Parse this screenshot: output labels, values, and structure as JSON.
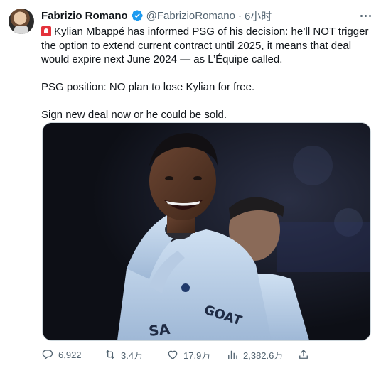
{
  "author": {
    "name": "Fabrizio Romano",
    "handle": "@FabrizioRomano",
    "separator": "·",
    "time": "6小时"
  },
  "tweet": {
    "paragraph1": "Kylian Mbappé has informed PSG of his decision: he’ll NOT trigger the option to extend current contract until 2025, it means that deal would expire next June 2024 — as L’Équipe called.",
    "paragraph2": "PSG position: NO plan to lose Kylian for free.",
    "paragraph3": "Sign new deal now or he could be sold."
  },
  "media": {
    "shirt_text": "GOAT",
    "shirt_text_lower": "SA"
  },
  "stats": {
    "replies": "6,922",
    "retweets": "3.4万",
    "likes": "17.9万",
    "views": "2,382.6万"
  },
  "icons": {
    "siren": "siren-emoji-icon",
    "verified": "verified-badge-icon",
    "more": "more-options-icon",
    "reply": "reply-icon",
    "retweet": "retweet-icon",
    "like": "heart-icon",
    "views": "views-bar-chart-icon",
    "share": "share-upload-icon"
  },
  "colors": {
    "text": "#0f1419",
    "secondary": "#536471",
    "verified": "#1d9bf0",
    "siren": "#e4323b"
  }
}
